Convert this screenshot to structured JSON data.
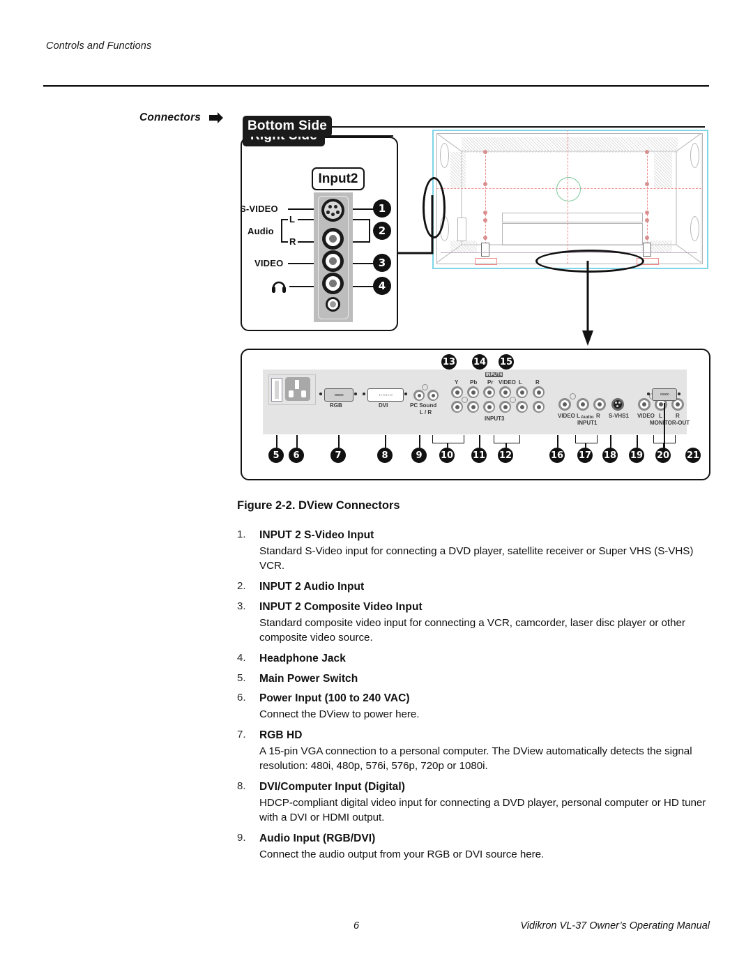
{
  "running_head": "Controls and Functions",
  "section_label": "Connectors",
  "figure": {
    "right_side": {
      "tab": "Right Side",
      "input_badge": "Input2",
      "labels": {
        "svideo": "S-VIDEO",
        "audio": "Audio",
        "audio_l": "L",
        "audio_r": "R",
        "video": "VIDEO",
        "headphone": "headphone-icon"
      },
      "callouts": [
        "1",
        "2",
        "3",
        "4"
      ]
    },
    "bottom_side": {
      "tab": "Bottom Side",
      "labels": {
        "rgb": "RGB",
        "dvi": "DVI",
        "pc_sound": "PC Sound",
        "pc_sound_lr": "L / R",
        "input4": "INPUT4",
        "y": "Y",
        "pb": "Pb",
        "pr": "Pr",
        "video_in4": "VIDEO",
        "l_in4": "L",
        "r_in4": "R",
        "input3": "INPUT3",
        "video_in1": "VIDEO",
        "audio_l1": "L",
        "audio_mid": "Audio",
        "audio_r1": "R",
        "svhs1": "S-VHS1",
        "input1": "INPUT1",
        "video_out": "VIDEO",
        "mon_l": "L",
        "mon_r": "R",
        "monitor_out": "MONITOR-OUT"
      },
      "callouts_top": [
        "13",
        "14",
        "15"
      ],
      "callouts_bottom": [
        "5",
        "6",
        "7",
        "8",
        "9",
        "10",
        "11",
        "12",
        "16",
        "17",
        "18",
        "19",
        "20",
        "21"
      ]
    }
  },
  "figure_caption": "Figure 2-2. DView Connectors",
  "items": [
    {
      "num": "1.",
      "title": "INPUT 2 S-Video Input",
      "desc": "Standard S-Video input for connecting a DVD player, satellite receiver or Super VHS (S-VHS) VCR."
    },
    {
      "num": "2.",
      "title": "INPUT 2 Audio Input",
      "desc": ""
    },
    {
      "num": "3.",
      "title": "INPUT 2 Composite Video Input",
      "desc": "Standard composite video input for connecting a VCR, camcorder, laser disc player or other composite video source."
    },
    {
      "num": "4.",
      "title": "Headphone Jack",
      "desc": ""
    },
    {
      "num": "5.",
      "title": "Main Power Switch",
      "desc": ""
    },
    {
      "num": "6.",
      "title": "Power Input (100 to 240 VAC)",
      "desc": "Connect the DView to power here."
    },
    {
      "num": "7.",
      "title": "RGB HD",
      "desc": "A 15-pin VGA connection to a personal computer. The DView automatically detects the signal resolution: 480i, 480p, 576i, 576p, 720p or 1080i."
    },
    {
      "num": "8.",
      "title": "DVI/Computer Input (Digital)",
      "desc": "HDCP-compliant digital video input for connecting a DVD player, personal computer or HD tuner with a DVI or HDMI output."
    },
    {
      "num": "9.",
      "title": "Audio Input (RGB/DVI)",
      "desc": "Connect the audio output from your RGB or DVI source here."
    }
  ],
  "footer": {
    "page_number": "6",
    "manual_title": "Vidikron VL-37 Owner’s Operating Manual"
  },
  "colors": {
    "ink": "#111111",
    "plate": "#e4e4e4",
    "strip": "#bdbdbd",
    "cad_outline": "#b4b4b4",
    "cad_red": "#f08a8a",
    "cad_green": "#7ec89b",
    "cad_cyan": "#7fd4e8"
  }
}
